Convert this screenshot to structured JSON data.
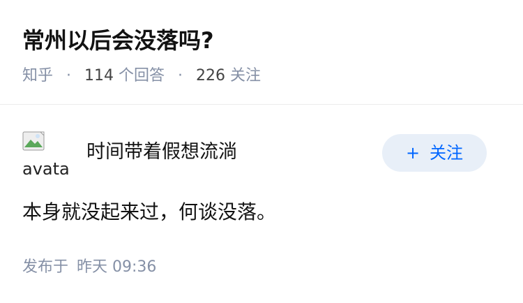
{
  "question": {
    "title": "常州以后会没落吗?",
    "source": "知乎",
    "answer_count": "114",
    "answer_label": "个回答",
    "follower_count": "226",
    "follower_label": "关注",
    "separator": "·"
  },
  "answer": {
    "avatar_alt": "avatar",
    "author_name": "时间带着假想流淌",
    "follow_button": {
      "plus": "+",
      "label": "关注"
    },
    "content": "本身就没起来过，何谈没落。",
    "published_label": "发布于",
    "published_time": "昨天 09:36"
  },
  "colors": {
    "accent": "#0066ff",
    "follow_button_bg": "#e8eff8",
    "meta_gray": "#8590a6"
  },
  "icons": {
    "avatar": "broken-image-icon"
  }
}
